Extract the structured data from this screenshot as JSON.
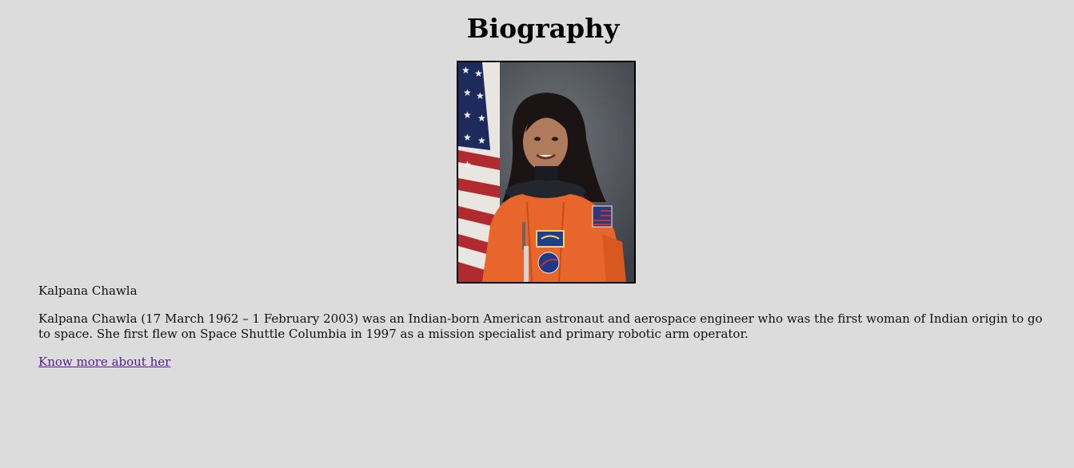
{
  "page": {
    "title": "Biography"
  },
  "profile": {
    "name": "Kalpana Chawla",
    "bio": "Kalpana Chawla (17 March 1962 – 1 February 2003) was an Indian-born American astronaut and aerospace engineer who was the first woman of Indian origin to go to space. She first flew on Space Shuttle Columbia in 1997 as a mission specialist and primary robotic arm operator.",
    "link_label": "Know more about her",
    "photo_icon": "astronaut-portrait"
  },
  "colors": {
    "background": "#dcdcdc",
    "link_visited": "#551a8b",
    "suit": "#e8662c"
  }
}
